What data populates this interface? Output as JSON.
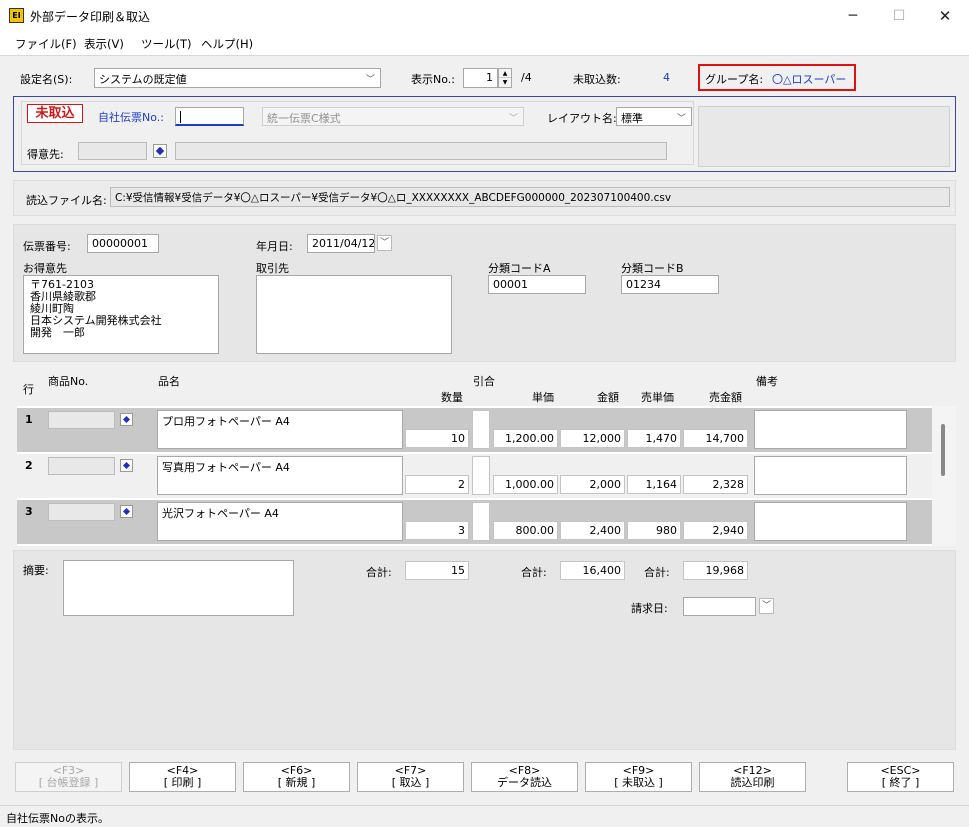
{
  "window": {
    "title": "外部データ印刷＆取込",
    "app_icon": "EI",
    "controls": {
      "minimize": "─",
      "maximize": "☐",
      "close": "✕"
    }
  },
  "menu": [
    {
      "label": "ファイル(F)"
    },
    {
      "label": "表示(V)"
    },
    {
      "label": "ツール(T)"
    },
    {
      "label": "ヘルプ(H)"
    }
  ],
  "settings": {
    "name_label": "設定名(S):",
    "name_value": "システムの既定値",
    "display_no_label": "表示No.:",
    "display_no_value": "1",
    "display_no_total": "/4",
    "unimported_label": "未取込数:",
    "unimported_value": "4",
    "group_label": "グループ名:",
    "group_value": "〇△ロスーパー"
  },
  "header_box": {
    "status_badge": "未取込",
    "slip_no_label": "自社伝票No.:",
    "slip_no_value": "",
    "slip_format": "統一伝票C様式",
    "layout_label": "レイアウト名:",
    "layout_value": "標準",
    "customer_label": "得意先:",
    "customer_code": "",
    "customer_name": ""
  },
  "file": {
    "label": "読込ファイル名:",
    "path": "C:¥受信情報¥受信データ¥〇△ロスーパー¥受信データ¥〇△ロ_XXXXXXXX_ABCDEFG000000_202307100400.csv"
  },
  "slip": {
    "number_label": "伝票番号:",
    "number_value": "00000001",
    "date_label": "年月日:",
    "date_value": "2011/04/12",
    "customer_label": "お得意先",
    "customer_lines": [
      "〒761-2103",
      "香川県綾歌郡",
      "綾川町陶",
      "日本システム開発株式会社",
      "開発　一郎"
    ],
    "supplier_label": "取引先",
    "class_a_label": "分類コードA",
    "class_a_value": "00001",
    "class_b_label": "分類コードB",
    "class_b_value": "01234"
  },
  "grid": {
    "headers": {
      "row": "行",
      "product_no": "商品No.",
      "product_name": "品名",
      "hikiai": "引合",
      "qty": "数量",
      "unit_price": "単価",
      "amount": "金額",
      "sell_price": "売単価",
      "sell_amount": "売金額",
      "note": "備考"
    },
    "rows": [
      {
        "line": "1",
        "name": "プロ用フォトペーパー A4",
        "qty": "10",
        "unit_price": "1,200.00",
        "amount": "12,000",
        "sell_price": "1,470",
        "sell_amount": "14,700"
      },
      {
        "line": "2",
        "name": "写真用フォトペーパー A4",
        "qty": "2",
        "unit_price": "1,000.00",
        "amount": "2,000",
        "sell_price": "1,164",
        "sell_amount": "2,328"
      },
      {
        "line": "3",
        "name": "光沢フォトペーパー A4",
        "qty": "3",
        "unit_price": "800.00",
        "amount": "2,400",
        "sell_price": "980",
        "sell_amount": "2,940"
      }
    ]
  },
  "totals": {
    "memo_label": "摘要:",
    "qty_label": "合計:",
    "qty_total": "15",
    "amount_label": "合計:",
    "amount_total": "16,400",
    "sell_label": "合計:",
    "sell_total": "19,968",
    "billing_label": "請求日:",
    "billing_value": ""
  },
  "buttons": [
    {
      "key": "<F3>",
      "label": "[ 台帳登録 ]",
      "enabled": false
    },
    {
      "key": "<F4>",
      "label": "[ 印刷 ]",
      "enabled": true
    },
    {
      "key": "<F6>",
      "label": "[ 新規 ]",
      "enabled": true
    },
    {
      "key": "<F7>",
      "label": "[ 取込 ]",
      "enabled": true
    },
    {
      "key": "<F8>",
      "label": "データ読込",
      "enabled": true
    },
    {
      "key": "<F9>",
      "label": "[ 未取込 ]",
      "enabled": true
    },
    {
      "key": "<F12>",
      "label": "読込印刷",
      "enabled": true
    },
    {
      "key": "<ESC>",
      "label": "[ 終了 ]",
      "enabled": true
    }
  ],
  "status_bar": "自社伝票Noの表示。",
  "colors": {
    "accent_blue": "#1e3cc8",
    "badge_red": "#d01818",
    "group_highlight": "#e01010"
  }
}
